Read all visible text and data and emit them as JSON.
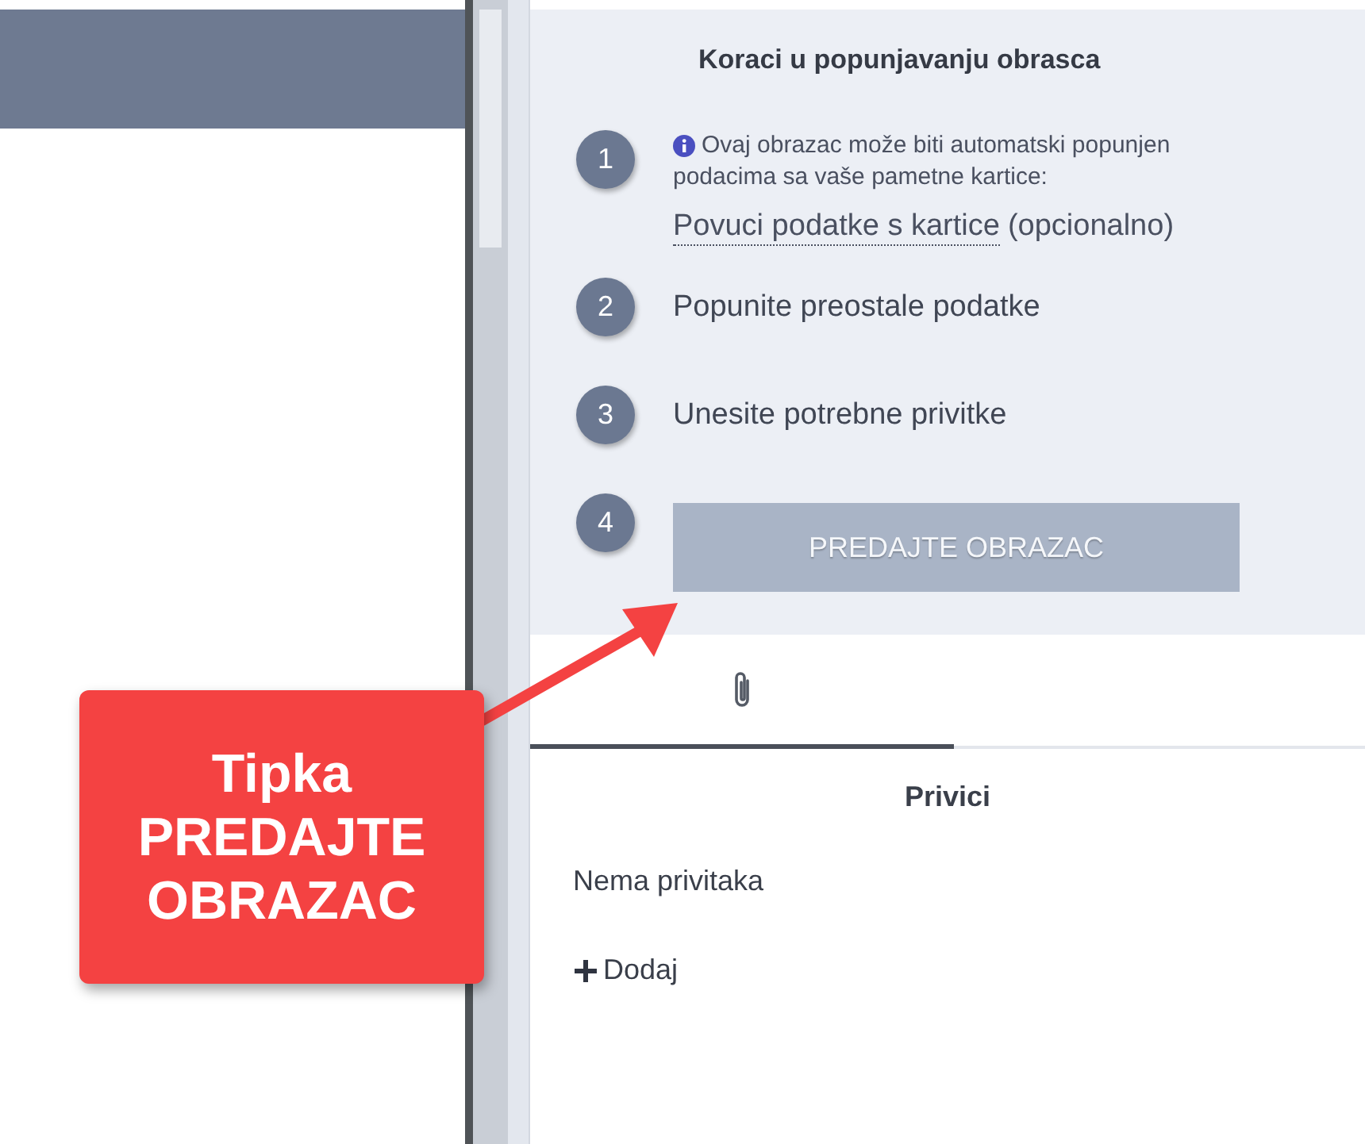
{
  "steps_panel": {
    "title": "Koraci u popunjavanju obrasca",
    "steps": [
      {
        "number": "1",
        "kind": "info",
        "info": "Ovaj obrazac može biti automatski popunjen",
        "info_more": "podacima sa vaše pametne kartice:",
        "link": "Povuci podatke s kartice",
        "link_note": "(opcionalno)"
      },
      {
        "number": "2",
        "kind": "text",
        "text": "Popunite preostale podatke"
      },
      {
        "number": "3",
        "kind": "text",
        "text": "Unesite potrebne privitke"
      },
      {
        "number": "4",
        "kind": "button",
        "text": "PREDAJTE OBRAZAC",
        "disabled": true
      }
    ]
  },
  "tabs": [
    {
      "selected": true
    }
  ],
  "attachments": {
    "title": "Privici",
    "empty_text": "Nema privitaka",
    "add_label": "Dodaj"
  },
  "callout": {
    "lines": [
      "Tipka",
      "PREDAJTE",
      "OBRAZAC"
    ]
  }
}
